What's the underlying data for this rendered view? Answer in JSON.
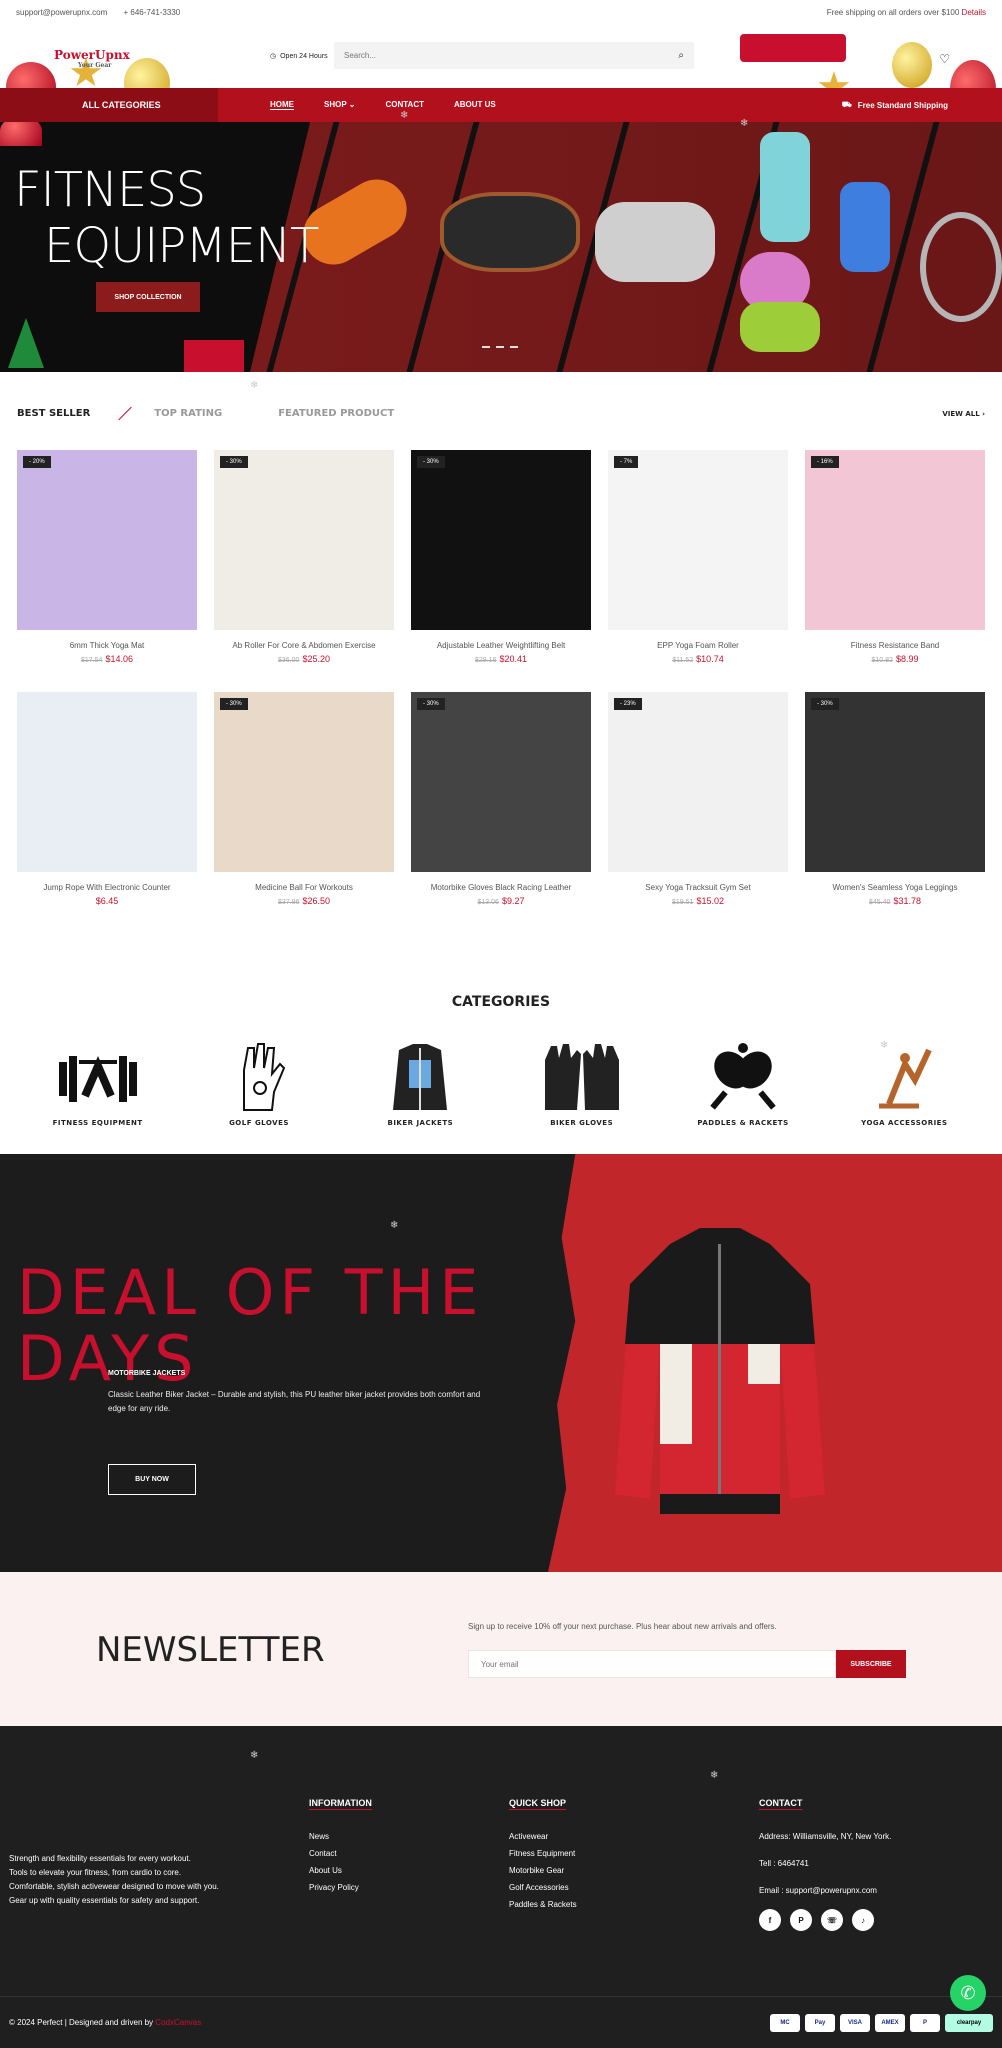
{
  "topbar": {
    "email": "support@powerupnx.com",
    "phone": "+ 646-741-3330",
    "shipping": "Free shipping on all orders over $100",
    "details_link": "Details"
  },
  "header": {
    "logo_text": "PowerUpnx",
    "logo_tag": "Your Gear",
    "open_hours": "Open 24 Hours",
    "search_placeholder": "Search..."
  },
  "nav": {
    "all_categories": "ALL CATEGORIES",
    "links": [
      "HOME",
      "SHOP",
      "CONTACT",
      "ABOUT US"
    ],
    "free_shipping": "Free Standard Shipping"
  },
  "hero": {
    "title_line1": "FITNESS",
    "title_line2": "EQUIPMENT",
    "button": "SHOP COLLECTION"
  },
  "product_tabs": {
    "tabs": [
      "BEST SELLER",
      "TOP RATING",
      "FEATURED PRODUCT"
    ],
    "view_all": "VIEW ALL"
  },
  "products": [
    {
      "name": "6mm Thick Yoga Mat",
      "old_price": "$17.54",
      "price": "$14.06",
      "badge": "- 20%"
    },
    {
      "name": "Ab Roller For Core & Abdomen Exercise",
      "old_price": "$36.00",
      "price": "$25.20",
      "badge": "- 30%"
    },
    {
      "name": "Adjustable Leather Weightlifting Belt",
      "old_price": "$29.16",
      "price": "$20.41",
      "badge": "- 30%"
    },
    {
      "name": "EPP Yoga Foam Roller",
      "old_price": "$11.52",
      "price": "$10.74",
      "badge": "- 7%"
    },
    {
      "name": "Fitness Resistance Band",
      "old_price": "$10.82",
      "price": "$8.99",
      "badge": "- 16%"
    },
    {
      "name": "Jump Rope With Electronic Counter",
      "old_price": "",
      "price": "$6.45",
      "badge": ""
    },
    {
      "name": "Medicine Ball For Workouts",
      "old_price": "$37.86",
      "price": "$26.50",
      "badge": "- 30%"
    },
    {
      "name": "Motorbike Gloves Black Racing Leather",
      "old_price": "$13.06",
      "price": "$9.27",
      "badge": "- 30%"
    },
    {
      "name": "Sexy Yoga Tracksuit Gym Set",
      "old_price": "$19.51",
      "price": "$15.02",
      "badge": "- 23%"
    },
    {
      "name": "Women's Seamless Yoga Leggings",
      "old_price": "$45.40",
      "price": "$31.78",
      "badge": "- 30%"
    }
  ],
  "categories": {
    "title": "CATEGORIES",
    "items": [
      "FITNESS EQUIPMENT",
      "GOLF GLOVES",
      "BIKER JACKETS",
      "BIKER GLOVES",
      "PADDLES & RACKETS",
      "YOGA ACCESSORIES"
    ]
  },
  "deal": {
    "title_line1": "DEAL OF THE",
    "title_line2": "DAYS",
    "subtitle": "MOTORBIKE JACKETS",
    "description": "Classic Leather Biker Jacket – Durable and stylish, this PU leather biker jacket provides both comfort and edge for any ride.",
    "button": "BUY NOW"
  },
  "newsletter": {
    "title": "NEWSLETTER",
    "text": "Sign up to receive 10% off your next purchase. Plus hear about new arrivals and offers.",
    "placeholder": "Your email",
    "button": "SUBSCRIBE"
  },
  "footer": {
    "about": [
      "Strength and flexibility essentials for every workout.",
      "Tools to elevate your fitness, from cardio to core.",
      "Comfortable, stylish activewear designed to move with you.",
      "Gear up with quality essentials for safety and support."
    ],
    "information": {
      "title": "INFORMATION",
      "links": [
        "News",
        "Contact",
        "About Us",
        "Privacy Policy"
      ]
    },
    "quick_shop": {
      "title": "QUICK SHOP",
      "links": [
        "Activewear",
        "Fitness Equipment",
        "Motorbike Gear",
        "Golf Accessories",
        "Paddles & Rackets"
      ]
    },
    "contact": {
      "title": "CONTACT",
      "address": "Address: Williamsville, NY, New York.",
      "tel": "Tell : 6464741",
      "email": "Email : support@powerupnx.com"
    },
    "copyright_prefix": "© 2024 Perfect | Designed and driven by",
    "copyright_brand": "CodxCanvas",
    "payments": [
      "MC",
      "Pay",
      "VISA",
      "AMEX",
      "P",
      "clearpay"
    ]
  },
  "colors": {
    "brand_red": "#b3101d",
    "accent_red": "#c8102e",
    "footer_bg": "#1f1f1f"
  }
}
